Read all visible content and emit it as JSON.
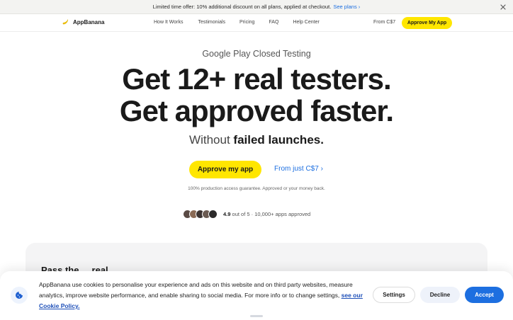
{
  "announcement": {
    "text": "Limited time offer: 10% additional discount on all plans, applied at checkout.",
    "link": "See plans ›"
  },
  "nav": {
    "brand": "AppBanana",
    "links": [
      "How It Works",
      "Testimonials",
      "Pricing",
      "FAQ",
      "Help Center"
    ],
    "price": "From C$7",
    "cta": "Approve My App"
  },
  "hero": {
    "eyebrow": "Google Play Closed Testing",
    "headline_line1": "Get 12+ real testers.",
    "headline_line2": "Get approved faster.",
    "sub_prefix": "Without ",
    "sub_bold": "failed launches.",
    "cta_primary": "Approve my app",
    "cta_secondary": "From just C$7 ›",
    "guarantee": "100% production access guarantee. Approved or your money back.",
    "rating_score": "4.9",
    "rating_rest": " out of 5 · 10,000+ apps approved"
  },
  "card": {
    "title_partial": "Pass the ... real"
  },
  "cookie": {
    "text": "AppBanana use cookies to personalise your experience and ads on this website and on third party websites, measure analytics, improve website performance, and enable sharing to social media. For more info or to change settings, ",
    "policy_link": "see our Cookie Policy.",
    "settings": "Settings",
    "decline": "Decline",
    "accept": "Accept"
  },
  "colors": {
    "accent_yellow": "#ffe600",
    "link_blue": "#1d6fe0",
    "accept_blue": "#1d6fe0"
  },
  "icons": {
    "close": "close-icon",
    "brand": "banana-logo-icon",
    "cookie": "cookie-icon"
  }
}
